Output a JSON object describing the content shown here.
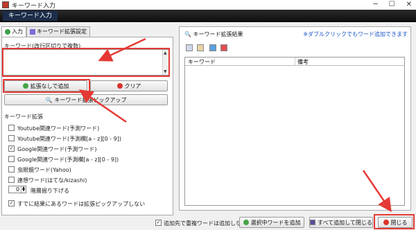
{
  "window": {
    "title": "キーワード入力",
    "controls": [
      "─",
      "☐",
      "✕"
    ]
  },
  "banner": {
    "title": "キーワード入力"
  },
  "tabs": [
    {
      "label": "入力",
      "active": true,
      "icon": "green-plus-icon"
    },
    {
      "label": "キーワード拡張設定",
      "active": false,
      "icon": "wrench-icon"
    }
  ],
  "input": {
    "label": "キーワード(改行区切りで複数)",
    "value": ""
  },
  "buttons": {
    "add_no_expand": "拡張なしで追加",
    "clear": "クリア",
    "expand_pickup": "キーワード拡張ピックアップ"
  },
  "expand": {
    "section_label": "キーワード拡張",
    "options": [
      {
        "label": "Youtube関連ワード(予測ワード)",
        "checked": false
      },
      {
        "label": "Youtube関連ワード(予測欄[a - z][0 - 9])",
        "checked": false
      },
      {
        "label": "Google関連ワード(予測ワード)",
        "checked": true
      },
      {
        "label": "Google関連ワード(予測欄[a - z][0 - 9])",
        "checked": false
      },
      {
        "label": "虫眼鏡ワード(Yahoo)",
        "checked": false
      },
      {
        "label": "連想ワード(はてな/kizashi)",
        "checked": false
      }
    ],
    "depth_value": "0",
    "depth_label": "階層掘り下げる",
    "skip_label": "すでに結果にあるワードは拡張ピックアップしない",
    "skip_checked": true
  },
  "results": {
    "title": "キーワード拡張結果",
    "hint": "※ダブルクリックでもワード追加できます",
    "columns": [
      "キーワード",
      "備考"
    ]
  },
  "footer": {
    "no_duplicate_label": "追加先で重複ワードは追加しない",
    "no_duplicate_checked": true,
    "add_selected": "選択中ワードを追加",
    "add_all_close": "すべて追加して閉じる",
    "close": "閉じる"
  },
  "colors": {
    "highlight": "#e53935",
    "hint_text": "#1a55c8"
  }
}
